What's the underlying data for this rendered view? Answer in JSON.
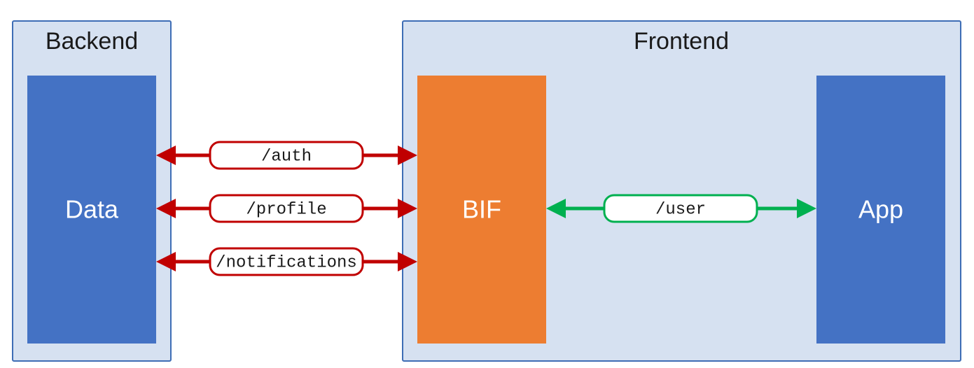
{
  "colors": {
    "group_fill": "#D6E1F1",
    "group_stroke": "#3E6DB5",
    "node_blue": "#4472C4",
    "node_orange": "#ED7D31",
    "arrow_red": "#C00000",
    "arrow_green": "#00B050"
  },
  "backend": {
    "title": "Backend",
    "node_label": "Data"
  },
  "frontend": {
    "title": "Frontend",
    "bif_label": "BIF",
    "app_label": "App"
  },
  "connections": {
    "red": [
      {
        "label": "/auth"
      },
      {
        "label": "/profile"
      },
      {
        "label": "/notifications"
      }
    ],
    "green": {
      "label": "/user"
    }
  }
}
